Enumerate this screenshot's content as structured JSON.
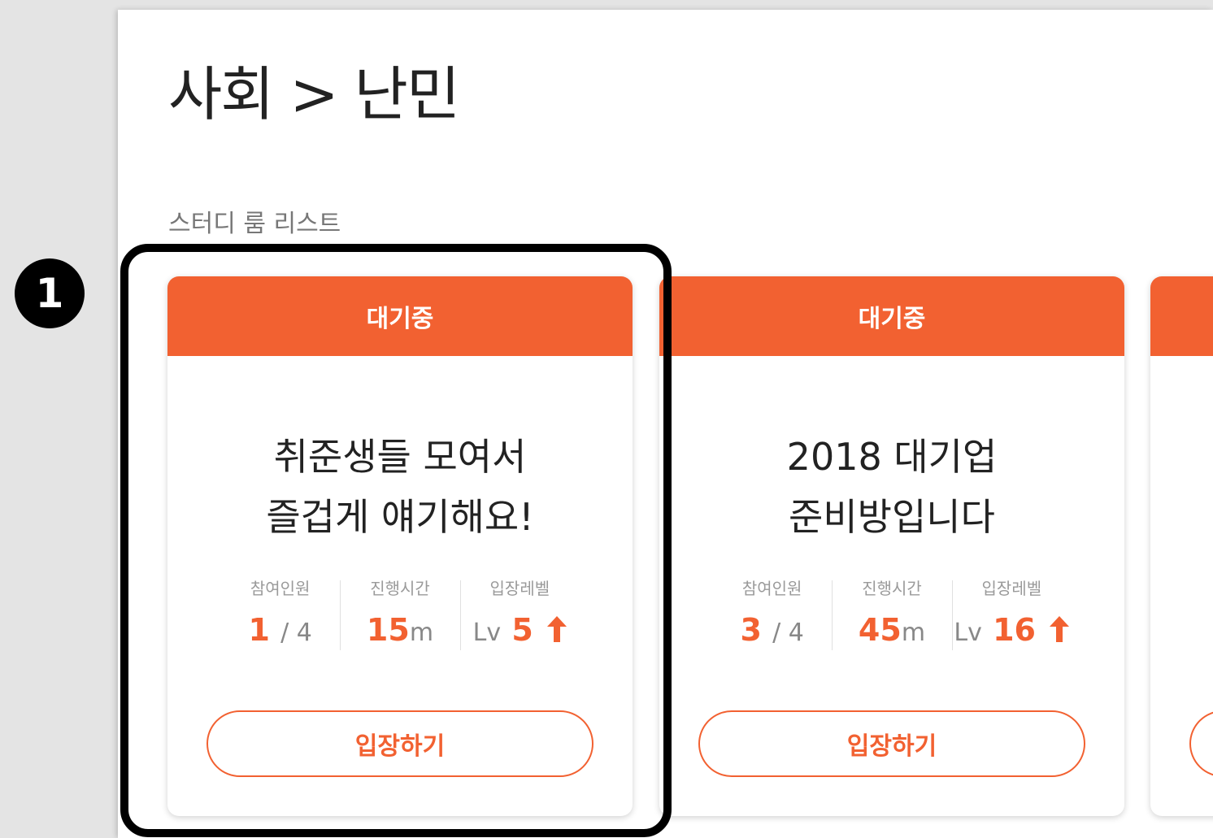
{
  "page_title": "사회 > 난민",
  "section_label": "스터디 룸 리스트",
  "step_marker": "1",
  "colors": {
    "accent": "#f26131",
    "text_dark": "#222222",
    "text_muted": "#9a9a9a"
  },
  "rooms": [
    {
      "status": "대기중",
      "title_line1": "취준생들 모여서",
      "title_line2": "즐겁게 얘기해요!",
      "participants_label": "참여인원",
      "participants_current": "1",
      "participants_max": "/ 4",
      "duration_label": "진행시간",
      "duration_value": "15",
      "duration_unit": "m",
      "level_label": "입장레벨",
      "level_prefix": "Lv",
      "level_value": "5",
      "level_icon": "arrow-up-icon",
      "enter_label": "입장하기"
    },
    {
      "status": "대기중",
      "title_line1": "2018 대기업",
      "title_line2": "준비방입니다",
      "participants_label": "참여인원",
      "participants_current": "3",
      "participants_max": "/ 4",
      "duration_label": "진행시간",
      "duration_value": "45",
      "duration_unit": "m",
      "level_label": "입장레벨",
      "level_prefix": "Lv",
      "level_value": "16",
      "level_icon": "arrow-up-icon",
      "enter_label": "입장하기"
    }
  ]
}
